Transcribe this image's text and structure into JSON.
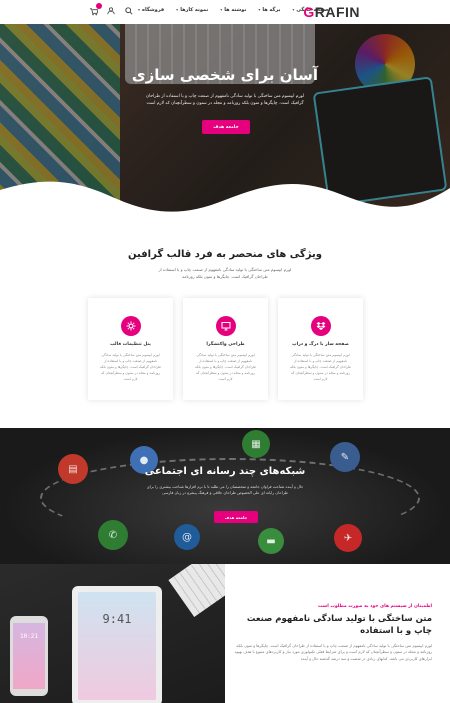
{
  "header": {
    "logo_first": "G",
    "logo_rest": "RAFIN",
    "nav": [
      {
        "label": "صفحه خانگی"
      },
      {
        "label": "برگه ها"
      },
      {
        "label": "نوشته ها"
      },
      {
        "label": "نمونه کارها"
      },
      {
        "label": "فروشگاه"
      }
    ],
    "icons": [
      "search-icon",
      "user-icon",
      "cart-icon"
    ]
  },
  "hero": {
    "title": "آسان برای شخصی سازی",
    "text": "لورم ایپسوم متن ساختگی با تولید سادگی نامفهوم از صنعت چاپ و با استفاده از طراحان گرافیک است. چاپگرها و متون بلکه روزنامه و مجله در ستون و سطرآنچنان که لازم است",
    "button": "جامعه هدف"
  },
  "features": {
    "title": "ویژگی های منحصر به فرد قالب گرافین",
    "subtitle": "لورم ایپسوم متن ساختگی با تولید سادگی نامفهوم از صنعت چاپ و با استفاده از طراحان گرافیک است. چاپگرها و متون بلکه روزنامه",
    "cards": [
      {
        "title": "صفحه ساز با درگ و دراپ",
        "icon": "dropbox-icon",
        "text": "لورم ایپسوم متن ساختگی با تولید سادگی نامفهوم از صنعت چاپ و با استفاده از طراحان گرافیک است. چاپگرها و متون بلکه روزنامه و مجله در ستون و سطرآنچنان که لازم است"
      },
      {
        "title": "طراحی واکنشگرا",
        "icon": "monitor-icon",
        "text": "لورم ایپسوم متن ساختگی با تولید سادگی نامفهوم از صنعت چاپ و با استفاده از طراحان گرافیک است. چاپگرها و متون بلکه روزنامه و مجله در ستون و سطرآنچنان که لازم است"
      },
      {
        "title": "پنل تنظیمات قالب",
        "icon": "settings-icon",
        "text": "لورم ایپسوم متن ساختگی با تولید سادگی نامفهوم از صنعت چاپ و با استفاده از طراحان گرافیک است. چاپگرها و متون بلکه روزنامه و مجله در ستون و سطرآنچنان که لازم است"
      }
    ]
  },
  "social": {
    "title": "شبکه‌های چند رسانه ای اجتماعی",
    "text": "حال و آینده شناخت فراوان جامعه و متخصصان را می طلبد تا با نرم افزارها شناخت بیشتری را برای طراحان رایانه ای علی الخصوص طراحان خلاقی و فرهنگ پیشرو در زبان فارسی",
    "button": "جامعه هدف"
  },
  "bottom": {
    "ipad_time": "9:41",
    "phone_time": "10:21",
    "kicker": "اطمینان از سیستم های خود به صورت مطلوب است",
    "title": "متن ساختگی با تولید سادگی نامفهوم صنعت چاپ و با استفاده",
    "text": "لورم ایپسوم متن ساختگی با تولید سادگی نامفهوم از صنعت چاپ و با استفاده از طراحان گرافیک است. چاپگرها و متون بلکه روزنامه و مجله در ستون و سطرآنچنان که لازم است و برای شرایط فعلی تکنولوژی مورد نیاز و کاربردهای متنوع با هدف بهبود ابزارهای کاربردی می باشد. کتابهای زیادی در شصت و سه درصد گذشته حال و آینده"
  },
  "colors": {
    "accent": "#e6007e",
    "dark": "#1c1c1c"
  }
}
